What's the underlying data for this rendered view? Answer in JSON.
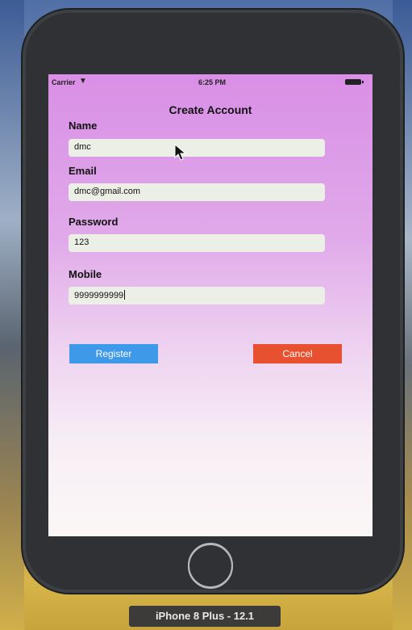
{
  "status_bar": {
    "carrier": "Carrier",
    "wifi_icon": "wifi-icon",
    "time": "6:25 PM",
    "battery_icon": "battery-icon"
  },
  "form": {
    "title": "Create Account",
    "name": {
      "label": "Name",
      "value": "dmc"
    },
    "email": {
      "label": "Email",
      "value": "dmc@gmail.com"
    },
    "password": {
      "label": "Password",
      "value": "123"
    },
    "mobile": {
      "label": "Mobile",
      "value": "9999999999"
    },
    "register_label": "Register",
    "cancel_label": "Cancel"
  },
  "simulator": {
    "device_label": "iPhone 8 Plus - 12.1",
    "home_button_icon": "home-button-icon"
  },
  "colors": {
    "register": "#3e9ae9",
    "cancel": "#e8512f",
    "gradient_top": "#d98fe6",
    "gradient_bottom": "#fbf7f6"
  }
}
